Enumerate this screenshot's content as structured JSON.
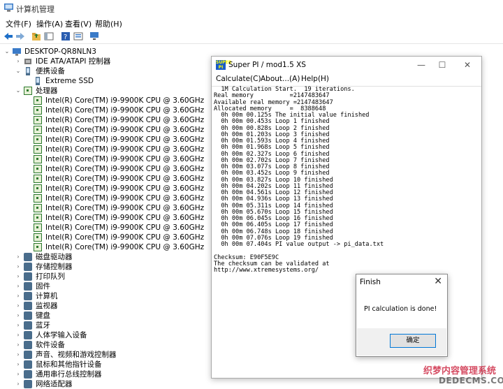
{
  "window": {
    "title": "计算机管理"
  },
  "menu": [
    "文件(F)",
    "操作(A)",
    "查看(V)",
    "帮助(H)"
  ],
  "tree": {
    "root": "DESKTOP-QR8NLN3",
    "ide": "IDE ATA/ATAPI 控制器",
    "portable": "便携设备",
    "ssd": "Extreme SSD",
    "processors": "处理器",
    "cpus": [
      "Intel(R) Core(TM) i9-9900K CPU @ 3.60GHz",
      "Intel(R) Core(TM) i9-9900K CPU @ 3.60GHz",
      "Intel(R) Core(TM) i9-9900K CPU @ 3.60GHz",
      "Intel(R) Core(TM) i9-9900K CPU @ 3.60GHz",
      "Intel(R) Core(TM) i9-9900K CPU @ 3.60GHz",
      "Intel(R) Core(TM) i9-9900K CPU @ 3.60GHz",
      "Intel(R) Core(TM) i9-9900K CPU @ 3.60GHz",
      "Intel(R) Core(TM) i9-9900K CPU @ 3.60GHz",
      "Intel(R) Core(TM) i9-9900K CPU @ 3.60GHz",
      "Intel(R) Core(TM) i9-9900K CPU @ 3.60GHz",
      "Intel(R) Core(TM) i9-9900K CPU @ 3.60GHz",
      "Intel(R) Core(TM) i9-9900K CPU @ 3.60GHz",
      "Intel(R) Core(TM) i9-9900K CPU @ 3.60GHz",
      "Intel(R) Core(TM) i9-9900K CPU @ 3.60GHz",
      "Intel(R) Core(TM) i9-9900K CPU @ 3.60GHz",
      "Intel(R) Core(TM) i9-9900K CPU @ 3.60GHz"
    ],
    "categories": [
      "磁盘驱动器",
      "存储控制器",
      "打印队列",
      "固件",
      "计算机",
      "监视器",
      "键盘",
      "蓝牙",
      "人体学输入设备",
      "软件设备",
      "声音、视频和游戏控制器",
      "鼠标和其他指针设备",
      "通用串行总线控制器",
      "网络适配器"
    ]
  },
  "superpi": {
    "title": "Super PI / mod1.5 XS",
    "logo": "SUPER PI",
    "menu": [
      "Calculate(C)",
      "About...(A)",
      "Help(H)"
    ],
    "lines": [
      "  1M Calculation Start.  19 iterations.",
      "Real memory          =2147483647",
      "Available real memory =2147483647",
      "Allocated memory     =  8388648",
      "  0h 00m 00.125s The initial value finished",
      "  0h 00m 00.453s Loop 1 finished",
      "  0h 00m 00.828s Loop 2 finished",
      "  0h 00m 01.203s Loop 3 finished",
      "  0h 00m 01.593s Loop 4 finished",
      "  0h 00m 01.968s Loop 5 finished",
      "  0h 00m 02.327s Loop 6 finished",
      "  0h 00m 02.702s Loop 7 finished",
      "  0h 00m 03.077s Loop 8 finished",
      "  0h 00m 03.452s Loop 9 finished",
      "  0h 00m 03.827s Loop 10 finished",
      "  0h 00m 04.202s Loop 11 finished",
      "  0h 00m 04.561s Loop 12 finished",
      "  0h 00m 04.936s Loop 13 finished",
      "  0h 00m 05.311s Loop 14 finished",
      "  0h 00m 05.670s Loop 15 finished",
      "  0h 00m 06.045s Loop 16 finished",
      "  0h 00m 06.405s Loop 17 finished",
      "  0h 00m 06.748s Loop 18 finished",
      "  0h 00m 07.076s Loop 19 finished",
      "  0h 00m 07.404s PI value output -> pi_data.txt",
      "",
      "Checksum: E90F5E9C",
      "The checksum can be validated at",
      "http://www.xtremesystems.org/"
    ]
  },
  "finish": {
    "title": "Finish",
    "message": "PI calculation is done!",
    "ok": "确定"
  },
  "watermark": {
    "line1": "织梦内容管理系统",
    "line2": "DEDECMS.COM"
  },
  "colors": {
    "accent": "#0078d7",
    "chip": "#2d7a2d"
  }
}
